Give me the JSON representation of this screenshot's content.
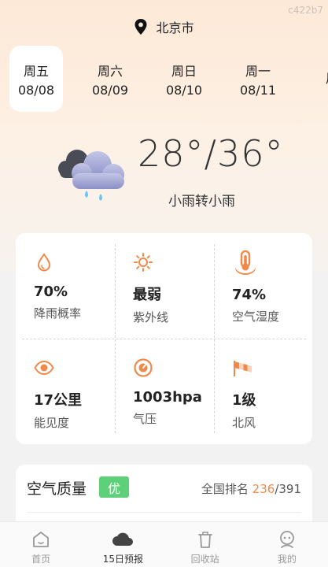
{
  "watermark": "c422b7",
  "location": {
    "city": "北京市",
    "icon": "location-pin-icon"
  },
  "days": [
    {
      "weekday": "周五",
      "date": "08/08",
      "active": true
    },
    {
      "weekday": "周六",
      "date": "08/09",
      "active": false
    },
    {
      "weekday": "周日",
      "date": "08/10",
      "active": false
    },
    {
      "weekday": "周一",
      "date": "08/11",
      "active": false
    },
    {
      "weekday": "周",
      "date": "",
      "active": false
    }
  ],
  "current": {
    "temperature": "28°/36°",
    "description": "小雨转小雨",
    "icon": "cloud-rain-icon"
  },
  "stats": [
    {
      "value": "70%",
      "label": "降雨概率",
      "icon": "raindrop-icon"
    },
    {
      "value": "最弱",
      "label": "紫外线",
      "icon": "sun-icon"
    },
    {
      "value": "74%",
      "label": "空气湿度",
      "icon": "thermometer-icon"
    },
    {
      "value": "17公里",
      "label": "能见度",
      "icon": "eye-icon"
    },
    {
      "value": "1003hpa",
      "label": "气压",
      "icon": "gauge-icon"
    },
    {
      "value": "1级",
      "label": "北风",
      "icon": "windsock-icon"
    }
  ],
  "air_quality": {
    "title": "空气质量",
    "level": "优",
    "rank_label": "全国排名",
    "rank": "236",
    "total": "/391"
  },
  "tabs": [
    {
      "label": "首页",
      "icon": "home-icon",
      "active": false
    },
    {
      "label": "15日预报",
      "icon": "cloud-icon",
      "active": true
    },
    {
      "label": "回收站",
      "icon": "trash-icon",
      "active": false
    },
    {
      "label": "我的",
      "icon": "robot-avatar-icon",
      "active": false
    }
  ],
  "colors": {
    "accent": "#f08a4b",
    "good": "#5fd07a"
  }
}
